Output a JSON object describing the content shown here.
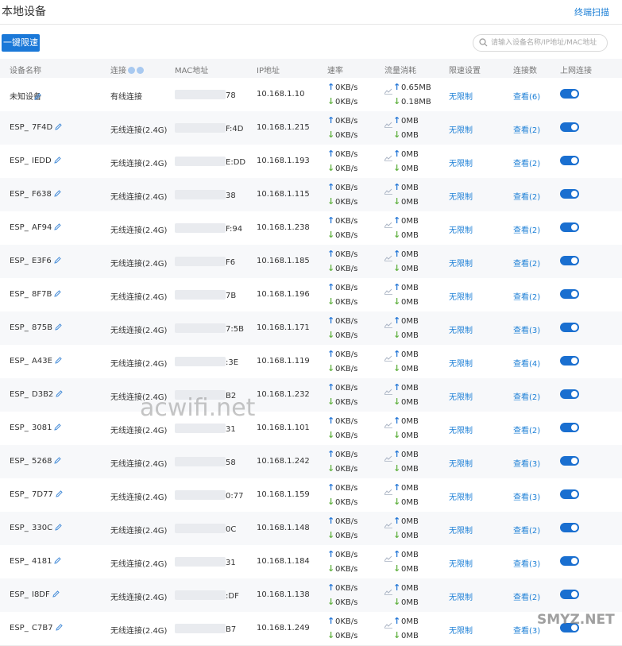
{
  "header": {
    "title": "本地设备",
    "top_link": "终端扫描"
  },
  "toolbar": {
    "limit_button": "一键限速",
    "search_placeholder": "请输入设备名称/IP地址/MAC地址"
  },
  "table": {
    "columns": [
      "设备名称",
      "连接",
      "MAC地址",
      "IP地址",
      "速率",
      "流量消耗",
      "限速设置",
      "连接数",
      "上网连接"
    ],
    "rows": [
      {
        "name_prefix": "未知设备",
        "name_suffix": "",
        "connection": "有线连接",
        "mac_tail": "78",
        "ip": "10.168.1.10",
        "rate_up": "0KB/s",
        "rate_down": "0KB/s",
        "traffic_up": "0.65MB",
        "traffic_down": "0.18MB",
        "limit": "无限制",
        "connections": "查看(6)",
        "online": true
      },
      {
        "name_prefix": "ESP_",
        "name_suffix": "7F4D",
        "connection": "无线连接(2.4G)",
        "mac_tail": "F:4D",
        "ip": "10.168.1.215",
        "rate_up": "0KB/s",
        "rate_down": "0KB/s",
        "traffic_up": "0MB",
        "traffic_down": "0MB",
        "limit": "无限制",
        "connections": "查看(2)",
        "online": true
      },
      {
        "name_prefix": "ESP_",
        "name_suffix": "IEDD",
        "connection": "无线连接(2.4G)",
        "mac_tail": "E:DD",
        "ip": "10.168.1.193",
        "rate_up": "0KB/s",
        "rate_down": "0KB/s",
        "traffic_up": "0MB",
        "traffic_down": "0MB",
        "limit": "无限制",
        "connections": "查看(2)",
        "online": true
      },
      {
        "name_prefix": "ESP_",
        "name_suffix": "F638",
        "connection": "无线连接(2.4G)",
        "mac_tail": "38",
        "ip": "10.168.1.115",
        "rate_up": "0KB/s",
        "rate_down": "0KB/s",
        "traffic_up": "0MB",
        "traffic_down": "0MB",
        "limit": "无限制",
        "connections": "查看(2)",
        "online": true
      },
      {
        "name_prefix": "ESP_",
        "name_suffix": "AF94",
        "connection": "无线连接(2.4G)",
        "mac_tail": "F:94",
        "ip": "10.168.1.238",
        "rate_up": "0KB/s",
        "rate_down": "0KB/s",
        "traffic_up": "0MB",
        "traffic_down": "0MB",
        "limit": "无限制",
        "connections": "查看(2)",
        "online": true
      },
      {
        "name_prefix": "ESP_",
        "name_suffix": "E3F6",
        "connection": "无线连接(2.4G)",
        "mac_tail": "F6",
        "ip": "10.168.1.185",
        "rate_up": "0KB/s",
        "rate_down": "0KB/s",
        "traffic_up": "0MB",
        "traffic_down": "0MB",
        "limit": "无限制",
        "connections": "查看(2)",
        "online": true
      },
      {
        "name_prefix": "ESP_",
        "name_suffix": "8F7B",
        "connection": "无线连接(2.4G)",
        "mac_tail": "7B",
        "ip": "10.168.1.196",
        "rate_up": "0KB/s",
        "rate_down": "0KB/s",
        "traffic_up": "0MB",
        "traffic_down": "0MB",
        "limit": "无限制",
        "connections": "查看(2)",
        "online": true
      },
      {
        "name_prefix": "ESP_",
        "name_suffix": "875B",
        "connection": "无线连接(2.4G)",
        "mac_tail": "7:5B",
        "ip": "10.168.1.171",
        "rate_up": "0KB/s",
        "rate_down": "0KB/s",
        "traffic_up": "0MB",
        "traffic_down": "0MB",
        "limit": "无限制",
        "connections": "查看(3)",
        "online": true
      },
      {
        "name_prefix": "ESP_",
        "name_suffix": "A43E",
        "connection": "无线连接(2.4G)",
        "mac_tail": ":3E",
        "ip": "10.168.1.119",
        "rate_up": "0KB/s",
        "rate_down": "0KB/s",
        "traffic_up": "0MB",
        "traffic_down": "0MB",
        "limit": "无限制",
        "connections": "查看(4)",
        "online": true
      },
      {
        "name_prefix": "ESP_",
        "name_suffix": "D3B2",
        "connection": "无线连接(2.4G)",
        "mac_tail": "B2",
        "ip": "10.168.1.232",
        "rate_up": "0KB/s",
        "rate_down": "0KB/s",
        "traffic_up": "0MB",
        "traffic_down": "0MB",
        "limit": "无限制",
        "connections": "查看(2)",
        "online": true
      },
      {
        "name_prefix": "ESP_",
        "name_suffix": "3081",
        "connection": "无线连接(2.4G)",
        "mac_tail": "31",
        "ip": "10.168.1.101",
        "rate_up": "0KB/s",
        "rate_down": "0KB/s",
        "traffic_up": "0MB",
        "traffic_down": "0MB",
        "limit": "无限制",
        "connections": "查看(2)",
        "online": true
      },
      {
        "name_prefix": "ESP_",
        "name_suffix": "5268",
        "connection": "无线连接(2.4G)",
        "mac_tail": "58",
        "ip": "10.168.1.242",
        "rate_up": "0KB/s",
        "rate_down": "0KB/s",
        "traffic_up": "0MB",
        "traffic_down": "0MB",
        "limit": "无限制",
        "connections": "查看(3)",
        "online": true
      },
      {
        "name_prefix": "ESP_",
        "name_suffix": "7D77",
        "connection": "无线连接(2.4G)",
        "mac_tail": "0:77",
        "ip": "10.168.1.159",
        "rate_up": "0KB/s",
        "rate_down": "0KB/s",
        "traffic_up": "0MB",
        "traffic_down": "0MB",
        "limit": "无限制",
        "connections": "查看(3)",
        "online": true
      },
      {
        "name_prefix": "ESP_",
        "name_suffix": "330C",
        "connection": "无线连接(2.4G)",
        "mac_tail": "0C",
        "ip": "10.168.1.148",
        "rate_up": "0KB/s",
        "rate_down": "0KB/s",
        "traffic_up": "0MB",
        "traffic_down": "0MB",
        "limit": "无限制",
        "connections": "查看(2)",
        "online": true
      },
      {
        "name_prefix": "ESP_",
        "name_suffix": "4181",
        "connection": "无线连接(2.4G)",
        "mac_tail": "31",
        "ip": "10.168.1.184",
        "rate_up": "0KB/s",
        "rate_down": "0KB/s",
        "traffic_up": "0MB",
        "traffic_down": "0MB",
        "limit": "无限制",
        "connections": "查看(3)",
        "online": true
      },
      {
        "name_prefix": "ESP_",
        "name_suffix": "I8DF",
        "connection": "无线连接(2.4G)",
        "mac_tail": ":DF",
        "ip": "10.168.1.138",
        "rate_up": "0KB/s",
        "rate_down": "0KB/s",
        "traffic_up": "0MB",
        "traffic_down": "0MB",
        "limit": "无限制",
        "connections": "查看(2)",
        "online": true
      },
      {
        "name_prefix": "ESP_",
        "name_suffix": "C7B7",
        "connection": "无线连接(2.4G)",
        "mac_tail": "B7",
        "ip": "10.168.1.249",
        "rate_up": "0KB/s",
        "rate_down": "0KB/s",
        "traffic_up": "0MB",
        "traffic_down": "0MB",
        "limit": "无限制",
        "connections": "查看(3)",
        "online": true
      }
    ]
  },
  "watermarks": [
    "acwifi.net",
    "SMYZ.NET"
  ],
  "colors": {
    "accent": "#1a78d8",
    "link": "#1c7fd6",
    "up_arrow": "#2577d6",
    "down_arrow": "#63b243"
  }
}
